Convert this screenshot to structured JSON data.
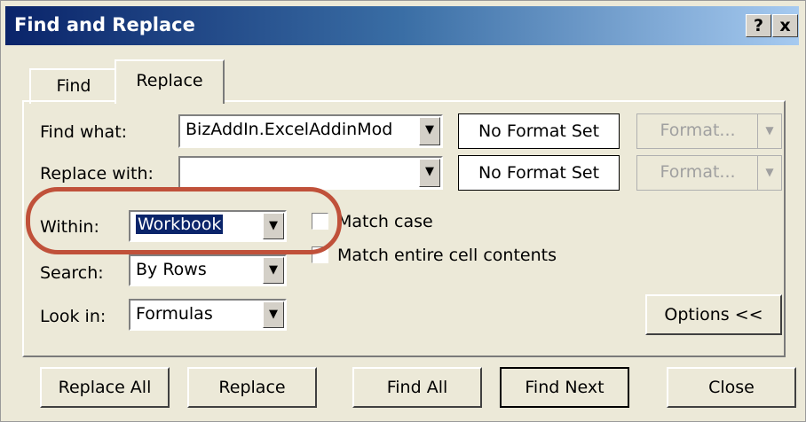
{
  "window": {
    "title": "Find and Replace",
    "help_icon": "?",
    "close_icon": "x"
  },
  "tabs": [
    {
      "label": "Find"
    },
    {
      "label": "Replace"
    }
  ],
  "fields": {
    "find_what_label": "Find what:",
    "find_what_value": "BizAddIn.ExcelAddinMod",
    "replace_with_label": "Replace with:",
    "replace_with_value": "",
    "find_format": "No Format Set",
    "replace_format": "No Format Set",
    "format_button": "Format...",
    "within_label": "Within:",
    "within_value": "Workbook",
    "search_label": "Search:",
    "search_value": "By Rows",
    "lookin_label": "Look in:",
    "lookin_value": "Formulas",
    "match_case": "Match case",
    "match_entire": "Match entire cell contents",
    "options_button": "Options <<"
  },
  "buttons": {
    "replace_all": "Replace All",
    "replace": "Replace",
    "find_all": "Find All",
    "find_next": "Find Next",
    "close": "Close"
  },
  "colors": {
    "title_bar": "#0a246a",
    "highlight_ring": "#c0513a"
  }
}
